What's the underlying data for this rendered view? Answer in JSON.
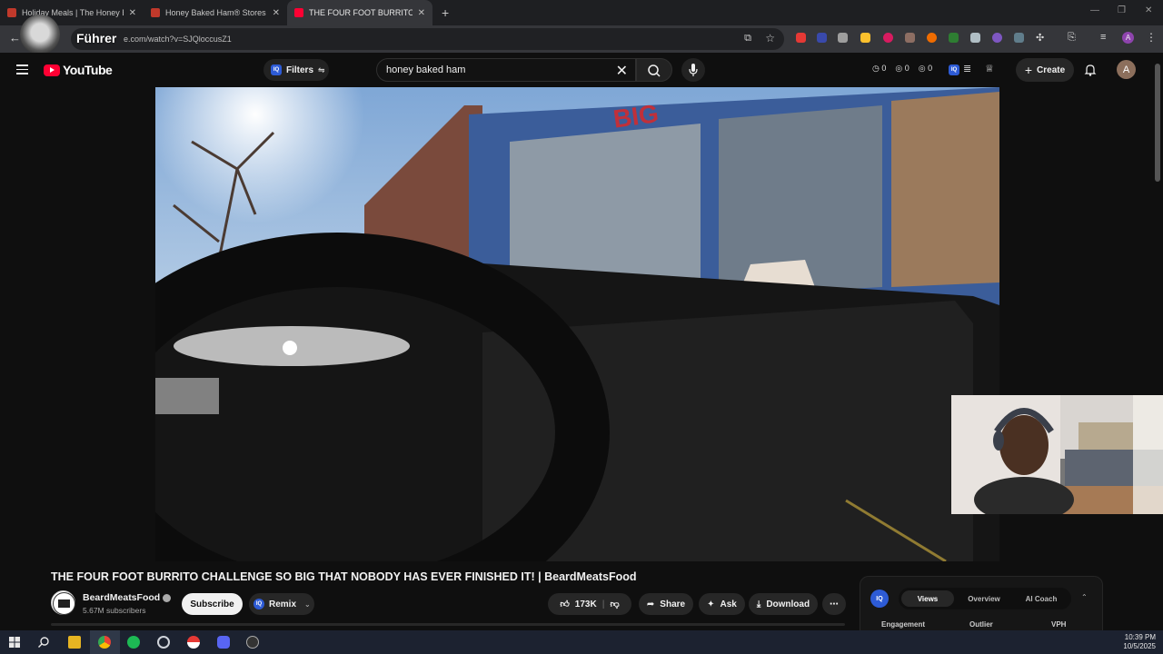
{
  "browser": {
    "tabs": [
      {
        "title": "Holiday Meals | The Honey Bak",
        "active": false
      },
      {
        "title": "Honey Baked Ham® Stores | H",
        "active": false
      },
      {
        "title": "THE FOUR FOOT BURRITO",
        "active": true
      }
    ],
    "url": "e.com/watch?v=SJQloccusZ1",
    "overlay_label": "Führer"
  },
  "youtube": {
    "logo_text": "YouTube",
    "filters_label": "Filters",
    "iq_short": "IQ",
    "search_value": "honey baked ham",
    "stats": [
      "0",
      "0",
      "0"
    ],
    "create_label": "Create",
    "avatar_letter": "A"
  },
  "video": {
    "title": "THE FOUR FOOT BURRITO CHALLENGE SO BIG THAT NOBODY HAS EVER FINISHED IT! | BeardMeatsFood",
    "channel_name": "BeardMeatsFood",
    "subscribers": "5.67M subscribers",
    "subscribe_label": "Subscribe",
    "remix_label": "Remix",
    "likes": "173K",
    "share_label": "Share",
    "ask_label": "Ask",
    "download_label": "Download",
    "store_sign": "BIG"
  },
  "iq_panel": {
    "tabs": [
      "Views",
      "Overview",
      "AI Coach"
    ],
    "active_tab": "Views",
    "columns": [
      "Engagement",
      "Outlier",
      "VPH"
    ]
  },
  "taskbar": {
    "time": "10:39 PM",
    "date": "10/5/2025"
  },
  "colors": {
    "youtube_red": "#ff0033",
    "iq_blue": "#2d5bd6",
    "background": "#0f0f0f"
  }
}
